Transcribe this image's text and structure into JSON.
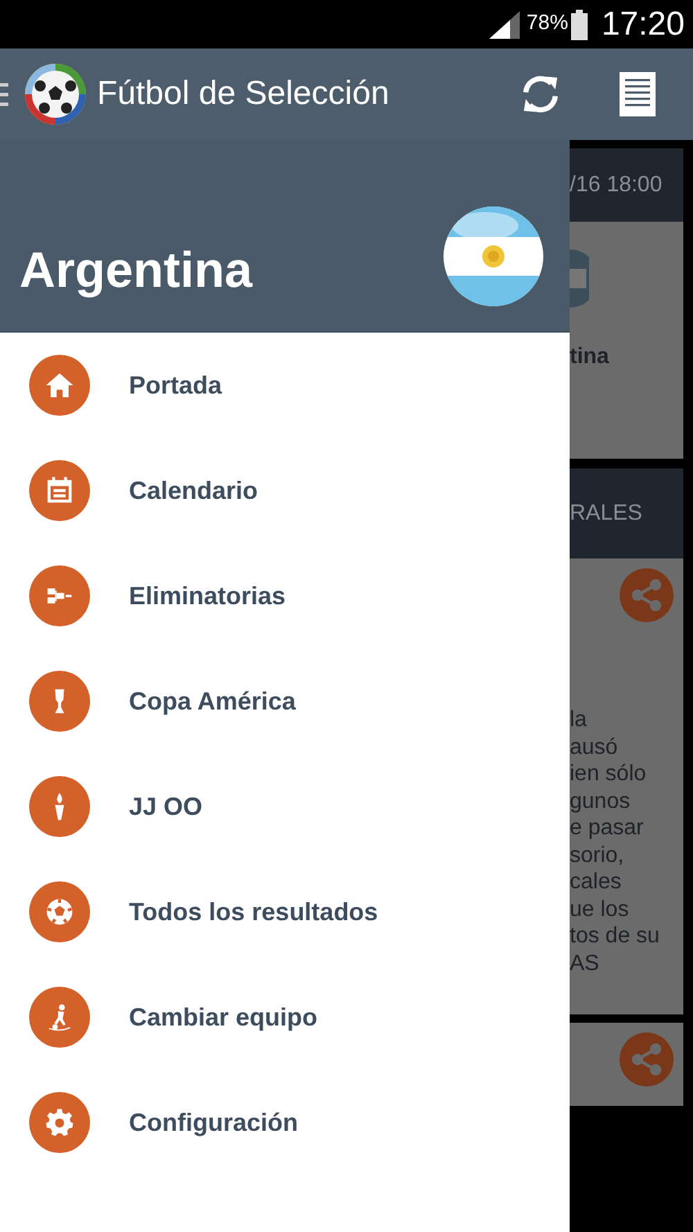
{
  "status_bar": {
    "battery": "78%",
    "time": "17:20"
  },
  "app_bar": {
    "title": "Fútbol de Selección"
  },
  "drawer": {
    "header": {
      "team": "Argentina"
    },
    "items": [
      {
        "label": "Portada"
      },
      {
        "label": "Calendario"
      },
      {
        "label": "Eliminatorias"
      },
      {
        "label": "Copa América"
      },
      {
        "label": "JJ OO"
      },
      {
        "label": "Todos los resultados"
      },
      {
        "label": "Cambiar equipo"
      },
      {
        "label": "Configuración"
      }
    ]
  },
  "background_content": [
    {
      "kind": "match",
      "date": "/16 18:00",
      "team": "tina"
    },
    {
      "kind": "section",
      "title": "RALES"
    },
    {
      "kind": "news",
      "lines": [
        "la",
        "ausó",
        "ien sólo",
        "gunos",
        "e pasar",
        "sorio,",
        "cales",
        "ue los",
        "tos de su",
        "AS"
      ]
    },
    {
      "kind": "news"
    }
  ]
}
